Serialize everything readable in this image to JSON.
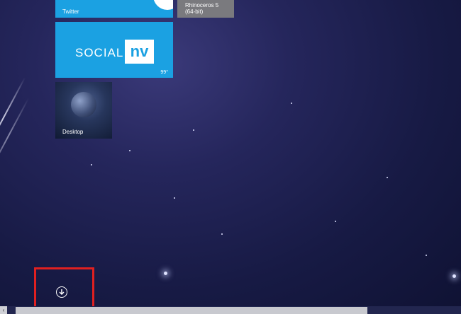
{
  "tiles": {
    "twitter": {
      "label": "Twitter",
      "color": "#1ba1e2"
    },
    "rhino": {
      "label_line1": "Rhinoceros 5",
      "label_line2": "(64-bit)",
      "color": "#7a7a7e"
    },
    "social": {
      "word": "SOCIAL",
      "badge": "nv",
      "temperature": "99°",
      "color": "#1ba1e2"
    },
    "desktop": {
      "label": "Desktop"
    }
  },
  "apps_button": {
    "icon": "down-arrow-circle-icon"
  },
  "highlight": {
    "color": "#e02020"
  },
  "scrollbar": {
    "left_arrow": "‹"
  }
}
